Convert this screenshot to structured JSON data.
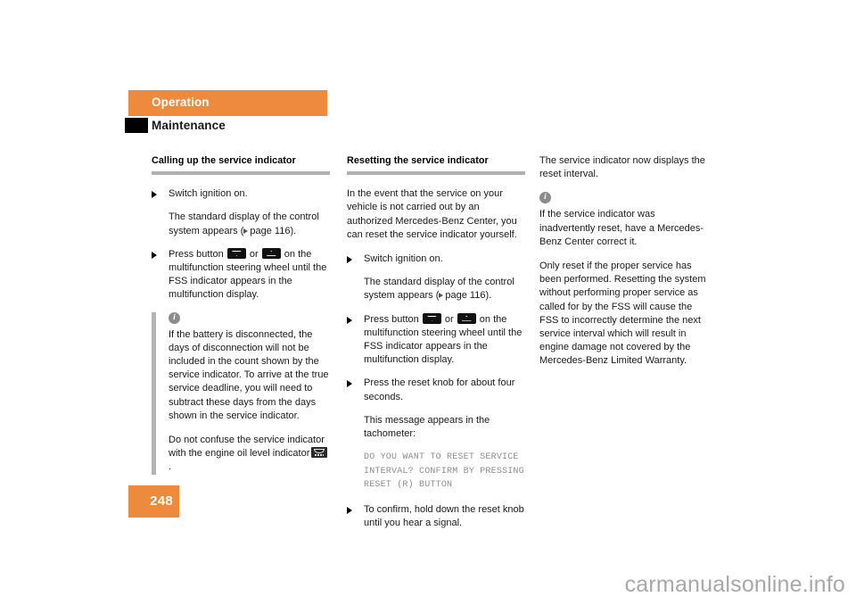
{
  "header": {
    "section_label": "Operation",
    "subsection_label": "Maintenance",
    "band_color": "#ee8a3c",
    "block_color": "#000000"
  },
  "columns": {
    "col1": {
      "heading": "Calling up the service indicator",
      "items": [
        {
          "type": "bullet",
          "text": "Switch ignition on."
        },
        {
          "type": "sub",
          "text_before": "The standard display of the control system appears (",
          "ref_page": "page 116",
          "text_after": ")."
        },
        {
          "type": "bullet_icons",
          "text_before": "Press button",
          "or_label": "or",
          "text_after": "on the multifunction steering wheel until the FSS indicator appears in the multifunction display.",
          "icon_1": "chevron-down-button-icon",
          "icon_2": "chevron-up-button-icon"
        }
      ],
      "note": {
        "icon": "info-icon",
        "paragraph_1": "If the battery is disconnected, the days of disconnection will not be included in the count shown by the service indicator. To arrive at the true service deadline, you will need to subtract these days from the days shown in the service indicator.",
        "paragraph_2_before": "Do not confuse the service indicator with the engine oil level indicator",
        "paragraph_2_icon": "engine-oil-level-indicator-icon",
        "paragraph_2_after": "."
      }
    },
    "col2": {
      "heading": "Resetting the service indicator",
      "intro": "In the event that the service on your vehicle is not carried out by an authorized Mercedes-Benz Center, you can reset the service indicator yourself.",
      "items": [
        {
          "type": "bullet",
          "text": "Switch ignition on."
        },
        {
          "type": "sub",
          "text_before": "The standard display of the control system appears (",
          "ref_page": "page 116",
          "text_after": ")."
        },
        {
          "type": "bullet_icons",
          "text_before": "Press button",
          "or_label": "or",
          "text_after": "on the multifunction steering wheel until the FSS indicator appears in the multifunction display.",
          "icon_1": "chevron-down-button-icon",
          "icon_2": "chevron-up-button-icon"
        },
        {
          "type": "bullet",
          "text": "Press the reset knob for about four seconds."
        },
        {
          "type": "sub",
          "text": "This message appears in the tachometer:"
        },
        {
          "type": "mono",
          "text": "DO YOU WANT TO RESET SERVICE INTERVAL? CONFIRM BY PRESSING RESET (R) BUTTON"
        },
        {
          "type": "bullet",
          "text": "To confirm, hold down the reset knob until you hear a signal."
        }
      ]
    },
    "col3": {
      "intro": "The service indicator now displays the reset interval.",
      "note": {
        "icon": "info-icon",
        "paragraph_1": "If the service indicator was inadvertently reset, have a Mercedes-Benz Center correct it.",
        "paragraph_2": "Only reset if the proper service has been performed. Resetting the system without performing proper service as called for by the FSS will cause the FSS to incorrectly determine the next service interval which will result in engine damage not covered by the Mercedes-Benz Limited Warranty."
      }
    }
  },
  "footer": {
    "page_number": "248",
    "page_block_color": "#ee8a3c",
    "watermark": "carmanualsonline.info"
  }
}
